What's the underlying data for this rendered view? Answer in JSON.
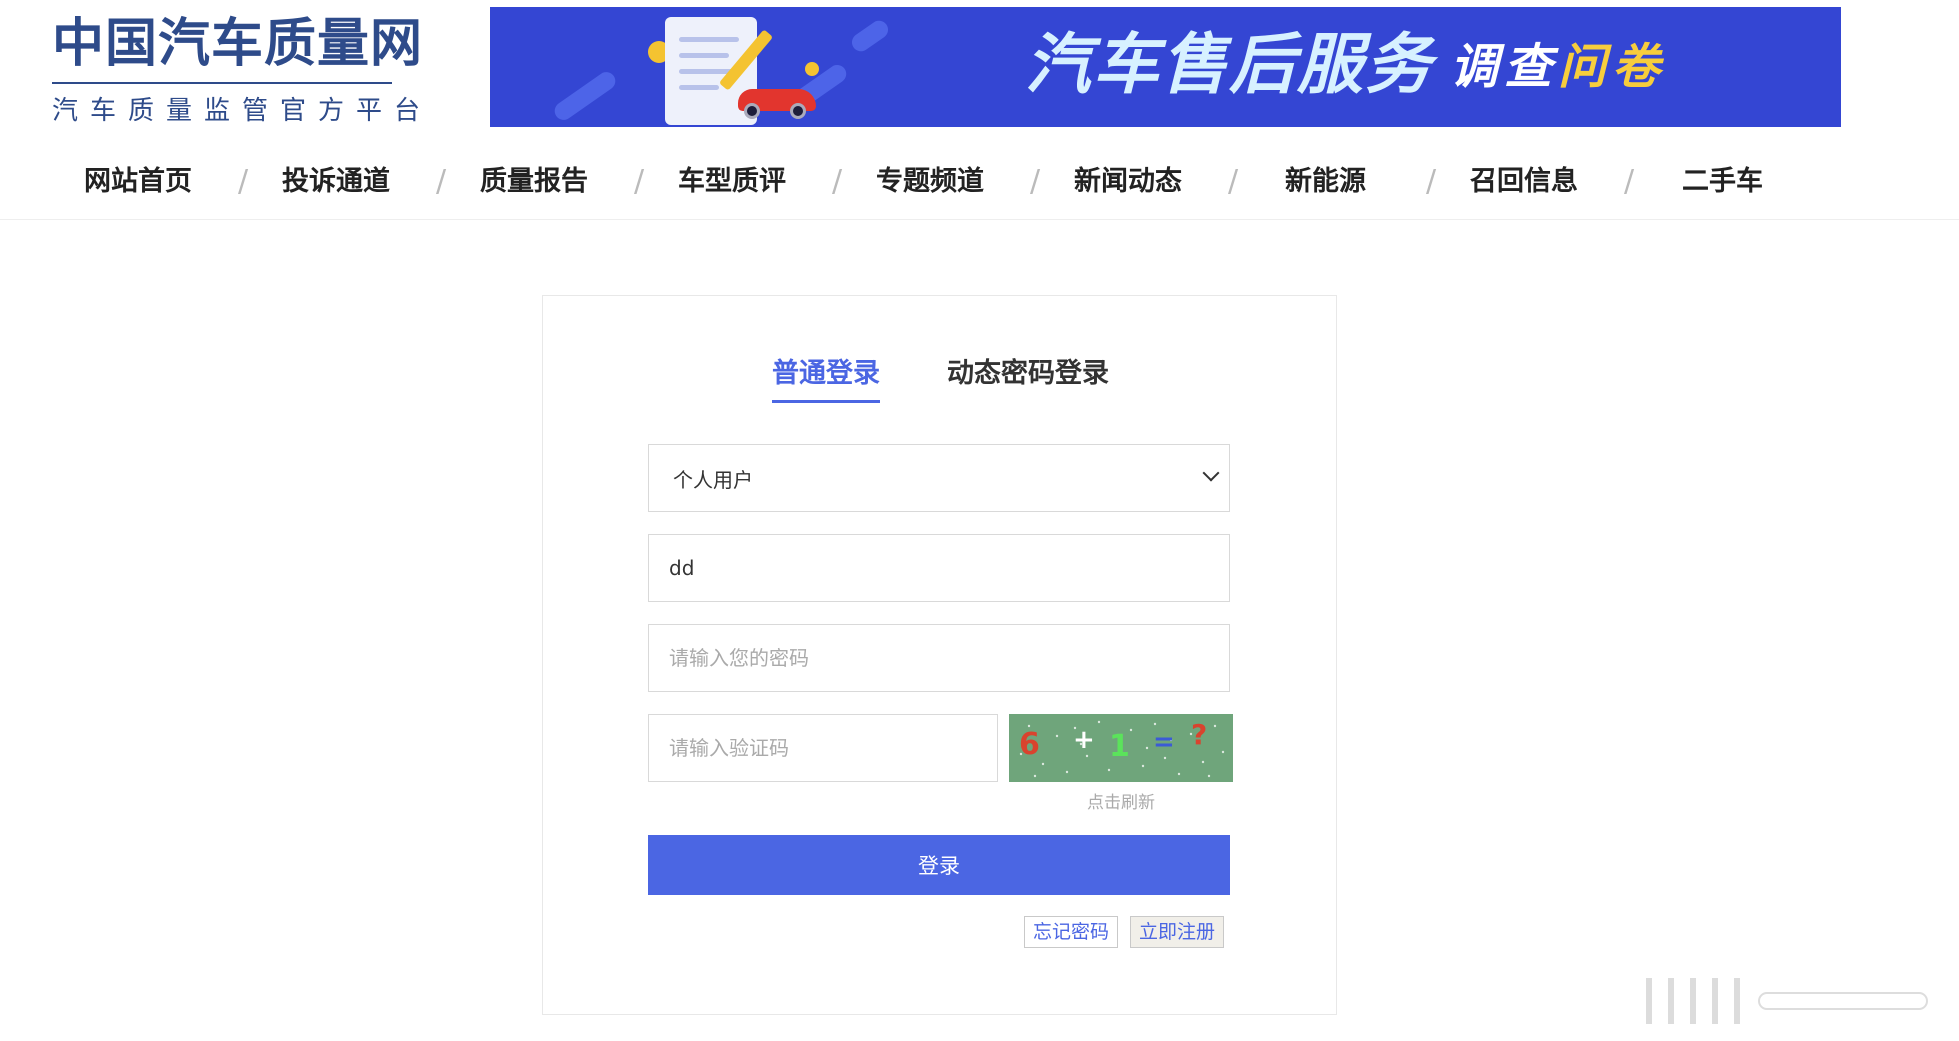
{
  "logo": {
    "title": "中国汽车质量网",
    "subtitle": "汽车质量监管官方平台"
  },
  "banner": {
    "title": "汽车售后服务",
    "subtitle_white": "调查",
    "subtitle_yellow": "问卷"
  },
  "nav": {
    "items": [
      "网站首页",
      "投诉通道",
      "质量报告",
      "车型质评",
      "专题频道",
      "新闻动态",
      "新能源",
      "召回信息",
      "二手车"
    ],
    "separator": "/"
  },
  "login": {
    "tabs": [
      "普通登录",
      "动态密码登录"
    ],
    "user_type": "个人用户",
    "username_value": "dd",
    "password_placeholder": "请输入您的密码",
    "captcha_placeholder": "请输入验证码",
    "captcha_text": [
      "6",
      "+",
      "1",
      "=",
      "?"
    ],
    "refresh_label": "点击刷新",
    "submit_label": "登录",
    "forgot_label": "忘记密码",
    "register_label": "立即注册"
  },
  "colors": {
    "brand": "#2e4b8a",
    "accent": "#4b66e3",
    "banner": "#3446d3",
    "captcha_bg": "#6fa57b"
  }
}
